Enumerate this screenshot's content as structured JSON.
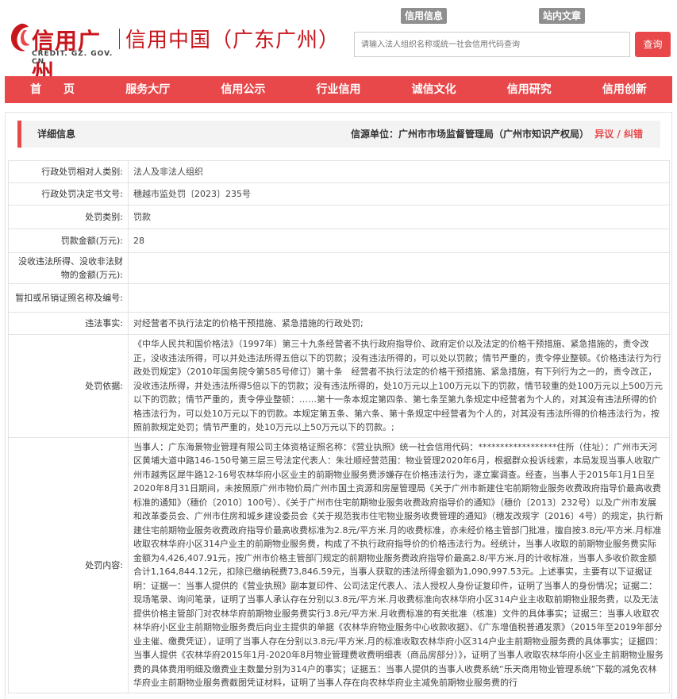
{
  "header": {
    "logo_title": "信用广州",
    "logo_domain": "CREDIT. GZ. GOV. CN",
    "site_name": "信用中国（广东广州）",
    "top_tabs": [
      "信用信息",
      "站内文章"
    ],
    "search_placeholder": "请输入法人组织名称或统一社会信用代码查询",
    "search_button": "查询"
  },
  "nav": {
    "items": [
      "首　　页",
      "服务大厅",
      "信用公示",
      "行业信用",
      "诚信文化",
      "信用研究",
      "信用创新"
    ]
  },
  "detail": {
    "title": "详细信息",
    "source": "信源单位：广州市市场监督管理局（广州市知识产权局）",
    "report": "异议 / 纠错"
  },
  "rows": [
    {
      "label": "行政处罚相对人类别:",
      "value": "法人及非法人组织"
    },
    {
      "label": "行政处罚决定书文号:",
      "value": "穗越市监处罚〔2023〕235号"
    },
    {
      "label": "处罚类别:",
      "value": "罚款"
    },
    {
      "label": "罚款金额(万元):",
      "value": "28"
    },
    {
      "label": "没收违法所得、没收非法财物的金额(万元):",
      "value": ""
    },
    {
      "label": "暂扣或吊销证照名称及编号:",
      "value": ""
    },
    {
      "label": "违法事实:",
      "value": "对经营者不执行法定的价格干预措施、紧急措施的行政处罚;"
    },
    {
      "label": "处罚依据:",
      "value": "《中华人民共和国价格法》（1997年）第三十九条经营者不执行政府指导价、政府定价以及法定的价格干预措施、紧急措施的，责令改正，没收违法所得，可以并处违法所得五倍以下的罚款；没有违法所得的，可以处以罚款；情节严重的，责令停业整顿。《价格违法行为行政处罚规定》（2010年国务院令第585号修订）第十条　经营者不执行法定的价格干预措施、紧急措施，有下列行为之一的，责令改正，没收违法所得，并处违法所得5倍以下的罚款；没有违法所得的，处10万元以上100万元以下的罚款，情节较重的处100万元以上500万元以下的罚款；情节严重的，责令停业整顿：……第十一条本规定第四条、第七条至第九条规定中经营者为个人的，对其没有违法所得的价格违法行为，可以处10万元以下的罚款。本规定第五条、第六条、第十条规定中经营者为个人的，对其没有违法所得的价格违法行为，按照前款规定处罚；情节严重的，处10万元以上50万元以下的罚款。;"
    },
    {
      "label": "处罚内容:",
      "value": "当事人：广东海景物业管理有限公司主体资格证照名称：《营业执照》统一社会信用代码：******************住所（住址）：广州市天河区黄埔大道中路146-150号第三层三号法定代表人：朱壮顺经营范围：物业管理2020年6月，根据群众投诉线索，本局发现当事人收取广州市越秀区犀牛路12-16号农林华府小区业主的前期物业服务费涉嫌存在价格违法行为，遂立案调查。经查，当事人于2015年1月1日至2020年8月31日期间，未按照原广州市物价局广州市国土资源和房屋管理局《关于广州市新建住宅前期物业服务收费政府指导价最高收费标准的通知》（穗价〔2010〕100号）、《关于广州市住宅前期物业服务收费政府指导价的通知》（穗价〔2013〕232号）以及广州市发展和改革委员会、广州市住房和城乡建设委员会《关于规范我市住宅物业服务收费管理的通知》（穗发改规字〔2016〕4号）的规定，执行新建住宅前期物业服务收费政府指导价最高收费标准为2.8元/平方米.月的收费标准，亦未经价格主管部门批准，擅自按3.8元/平方米.月标准收取农林华府小区314户业主的前期物业服务费，构成了不执行政府指导价的价格违法行为。经统计，当事人收取的前期物业服务费实际金额为4,426,407.91元，按广州市价格主管部门规定的前期物业服务费政府指导价最高2.8/平方米.月的计收标准，当事人多收价款金额合计1,164,844.12元，扣除已缴纳税费73,846.59元，当事人获取的违法所得金额为1,090,997.53元。上述事实，主要有以下证据证明：证据一：当事人提供的《营业执照》副本复印件、公司法定代表人、法人授权人身份证复印件，证明了当事人的身份情况；证据二：现场笔录、询问笔录，证明了当事人承认存在分别以3.8元/平方米.月收费标准向农林华府小区314户业主收取前期物业服务费，以及无法提供价格主管部门对农林华府前期物业服务费实行3.8元/平方米.月收费标准的有关批准（核准）文件的具体事实；证据三：当事人收取农林华府小区业主前期物业服务费后向业主提供的单据《农林华府物业服务中心收款收据》、《广东增值税普通发票》（2015年至2019年部分业主催、缴费凭证），证明了当事人存在分别以3.8元/平方米.月的标准收取农林华府小区314户业主前期物业服务费的具体事实；证据四：当事人提供《农林华府2015年1月-2020年8月物业管理费收费明细表（商品房部分）》，证明了当事人收取农林华府小区业主前期物业服务费的具体费用明细及缴费业主数量分别为314户的事实；证据五：当事人提供的当事人收费系统“乐天商用物业管理系统”下载的减免农林华府业主前期物业服务费截图凭证材料，证明了当事人存在向农林华府业主减免前期物业服务费的行"
    }
  ],
  "colors": {
    "accent": "#e8484a",
    "brand_red": "#c8161d",
    "tab_gray": "#8f8f8f"
  }
}
